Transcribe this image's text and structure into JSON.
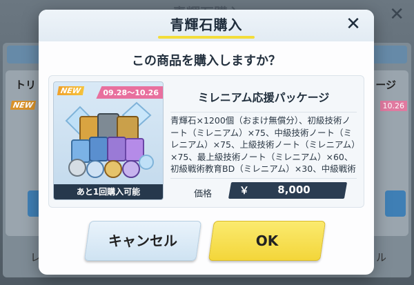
{
  "background": {
    "title": "青輝石購入",
    "left_card_text": "トリ",
    "right_card_text": "ージ",
    "left_new_badge": "NEW",
    "right_date_fragment": "10.26",
    "left_bottom_letter": "レ",
    "right_bottom_letter": "ル"
  },
  "dialog": {
    "title": "青輝石購入",
    "question": "この商品を購入しますか？",
    "item": {
      "new_badge": "NEW",
      "date_range": "09.28～10.26",
      "limit_text": "あと1回購入可能",
      "name": "ミレニアム応援パッケージ",
      "description": "青輝石×1200個（おまけ無償分）、初級技術ノート（ミレニアム）×75、中級技術ノート（ミレニアム）×75、上級技術ノート（ミレニアム）×75、最上級技術ノート（ミレニアム）×60、初級戦術教育BD（ミレニアム）×30、中級戦術教育BD（ミレニアム）",
      "price_label": "価格",
      "currency_symbol": "￥",
      "price": "8,000"
    },
    "buttons": {
      "cancel": "キャンセル",
      "ok": "OK"
    }
  },
  "colors": {
    "accent_yellow": "#f3d63a",
    "price_bg": "#2b3d52",
    "date_pink": "#e8709e"
  }
}
